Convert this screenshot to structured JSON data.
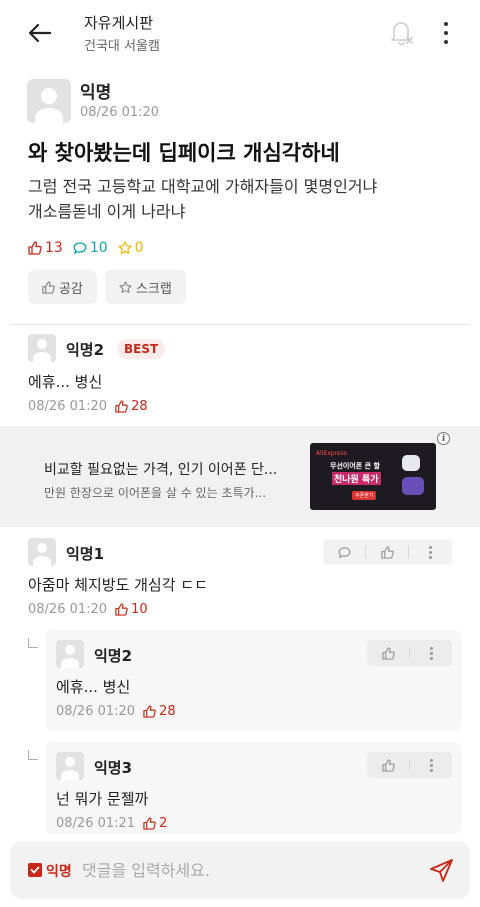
{
  "header": {
    "title": "자유게시판",
    "subtitle": "건국대 서울캠",
    "icons": [
      "back-arrow-icon",
      "bell-off-icon",
      "more-vertical-icon"
    ]
  },
  "post": {
    "author": "익명",
    "time": "08/26 01:20",
    "title": "와 찾아봤는데 딥페이크 개심각하네",
    "body_lines": [
      "그럼 전국 고등학교 대학교에 가해자들이 몇명인거냐",
      "개소름돋네 이게 나라냐"
    ],
    "likes": "13",
    "comments": "10",
    "scraps": "0",
    "like_button": "공감",
    "scrap_button": "스크랩"
  },
  "comments": [
    {
      "author": "익명2",
      "badge": "BEST",
      "text": "에휴... 병신",
      "time": "08/26 01:20",
      "likes": "28"
    },
    {
      "author": "익명1",
      "text": "아줌마 체지방도 개심각 ㄷㄷ",
      "time": "08/26 01:20",
      "likes": "10"
    }
  ],
  "replies": [
    {
      "author": "익명2",
      "text": "에휴... 병신",
      "time": "08/26 01:20",
      "likes": "28"
    },
    {
      "author": "익명3",
      "text": "넌 뭐가 문젤까",
      "time": "08/26 01:21",
      "likes": "2"
    }
  ],
  "ad": {
    "title": "비교할 필요없는 가격, 인기 이어폰 단...",
    "subtitle": "만원 한장으로 이어폰을 살 수 있는 초특가...",
    "image_label_small": "AliExpress",
    "image_line1": "무선이어폰 큰 할",
    "image_line2": "천나원 특가",
    "image_cta": "쿠폰받기",
    "info_icon": "i"
  },
  "composer": {
    "anon_label": "익명",
    "placeholder": "댓글을 입력하세요."
  },
  "colors": {
    "accent": "#c62917",
    "comment_count": "#0ca5af",
    "scrap_count": "#f0b400"
  }
}
